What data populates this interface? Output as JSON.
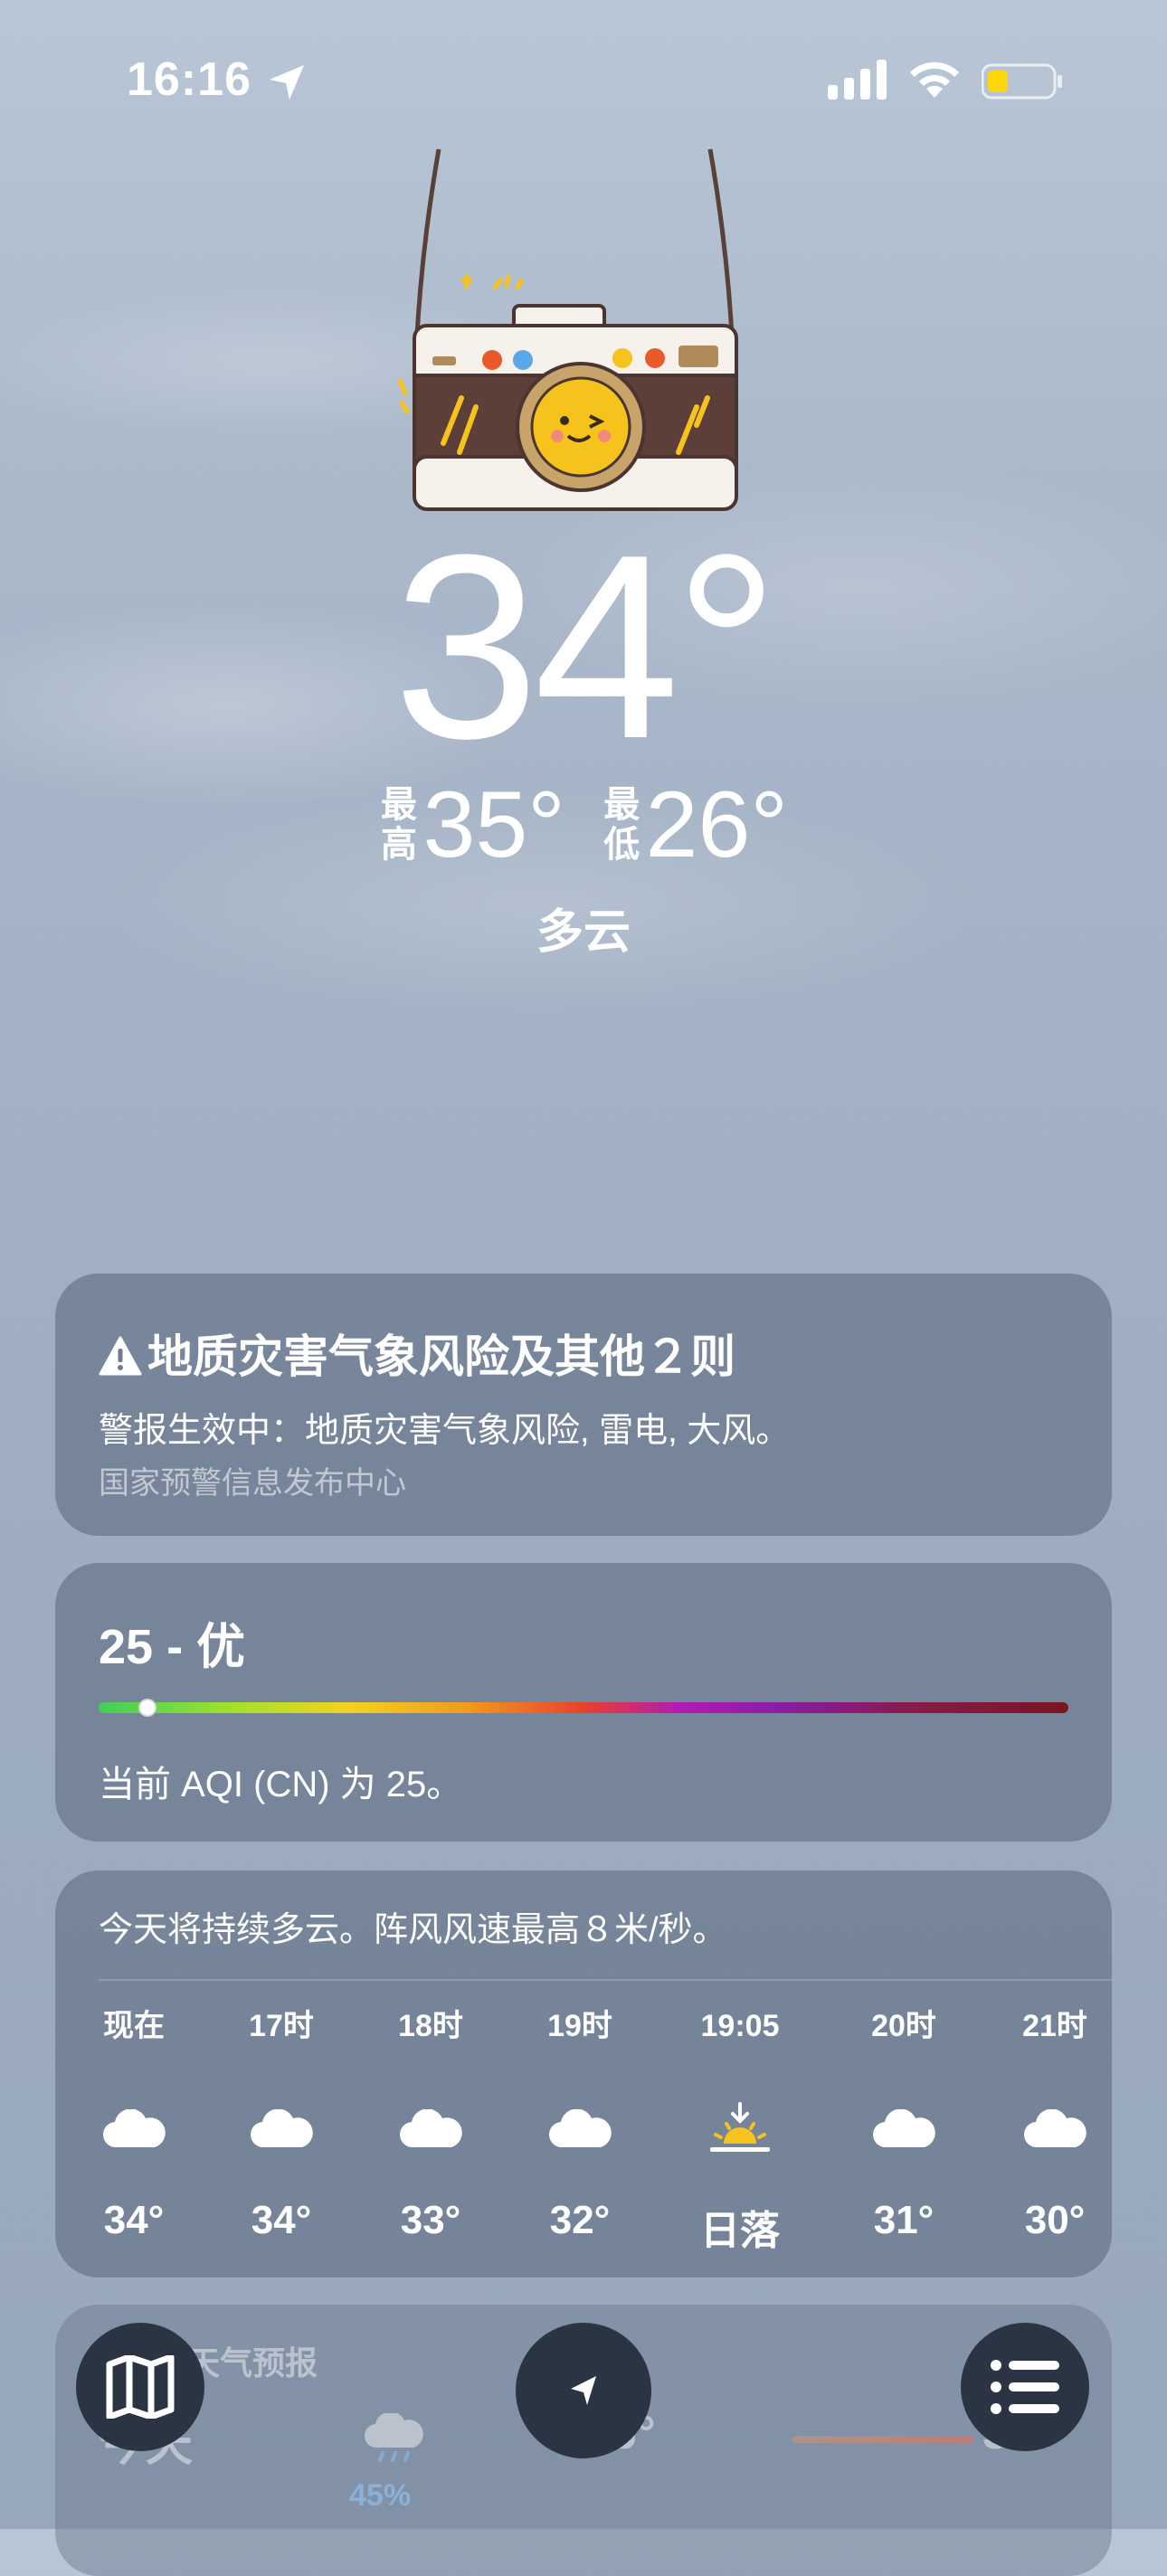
{
  "status_bar": {
    "time": "16:16"
  },
  "hero": {
    "temperature": "34°",
    "high_label": "最高",
    "high_value": "35°",
    "low_label": "最低",
    "low_value": "26°",
    "condition": "多云"
  },
  "alert": {
    "title": "地质灾害气象风险及其他２则",
    "body": "警报生效中：地质灾害气象风险, 雷电, 大风。",
    "source": "国家预警信息发布中心"
  },
  "aqi": {
    "title": "25 - 优",
    "description": "当前 AQI (CN) 为 25。",
    "level_fraction": 0.05
  },
  "hourly": {
    "summary": "今天将持续多云。阵风风速最高８米/秒。",
    "items": [
      {
        "hour": "现在",
        "icon": "cloud-icon",
        "temp": "34°"
      },
      {
        "hour": "17时",
        "icon": "cloud-icon",
        "temp": "34°"
      },
      {
        "hour": "18时",
        "icon": "cloud-icon",
        "temp": "33°"
      },
      {
        "hour": "19时",
        "icon": "cloud-icon",
        "temp": "32°"
      },
      {
        "hour": "19:05",
        "icon": "sunset-icon",
        "temp": "日落"
      },
      {
        "hour": "20时",
        "icon": "cloud-icon",
        "temp": "31°"
      },
      {
        "hour": "21时",
        "icon": "cloud-icon",
        "temp": "30°"
      }
    ]
  },
  "daily": {
    "title": "日天气预报",
    "today_label": "今天",
    "precip": "45%",
    "low": "26°",
    "high": "35°"
  },
  "colors": {
    "card_bg": "#68768c",
    "fab_bg": "#2b3443",
    "sunset_yellow": "#f6c21c",
    "battery_yellow": "#ffd60a"
  }
}
